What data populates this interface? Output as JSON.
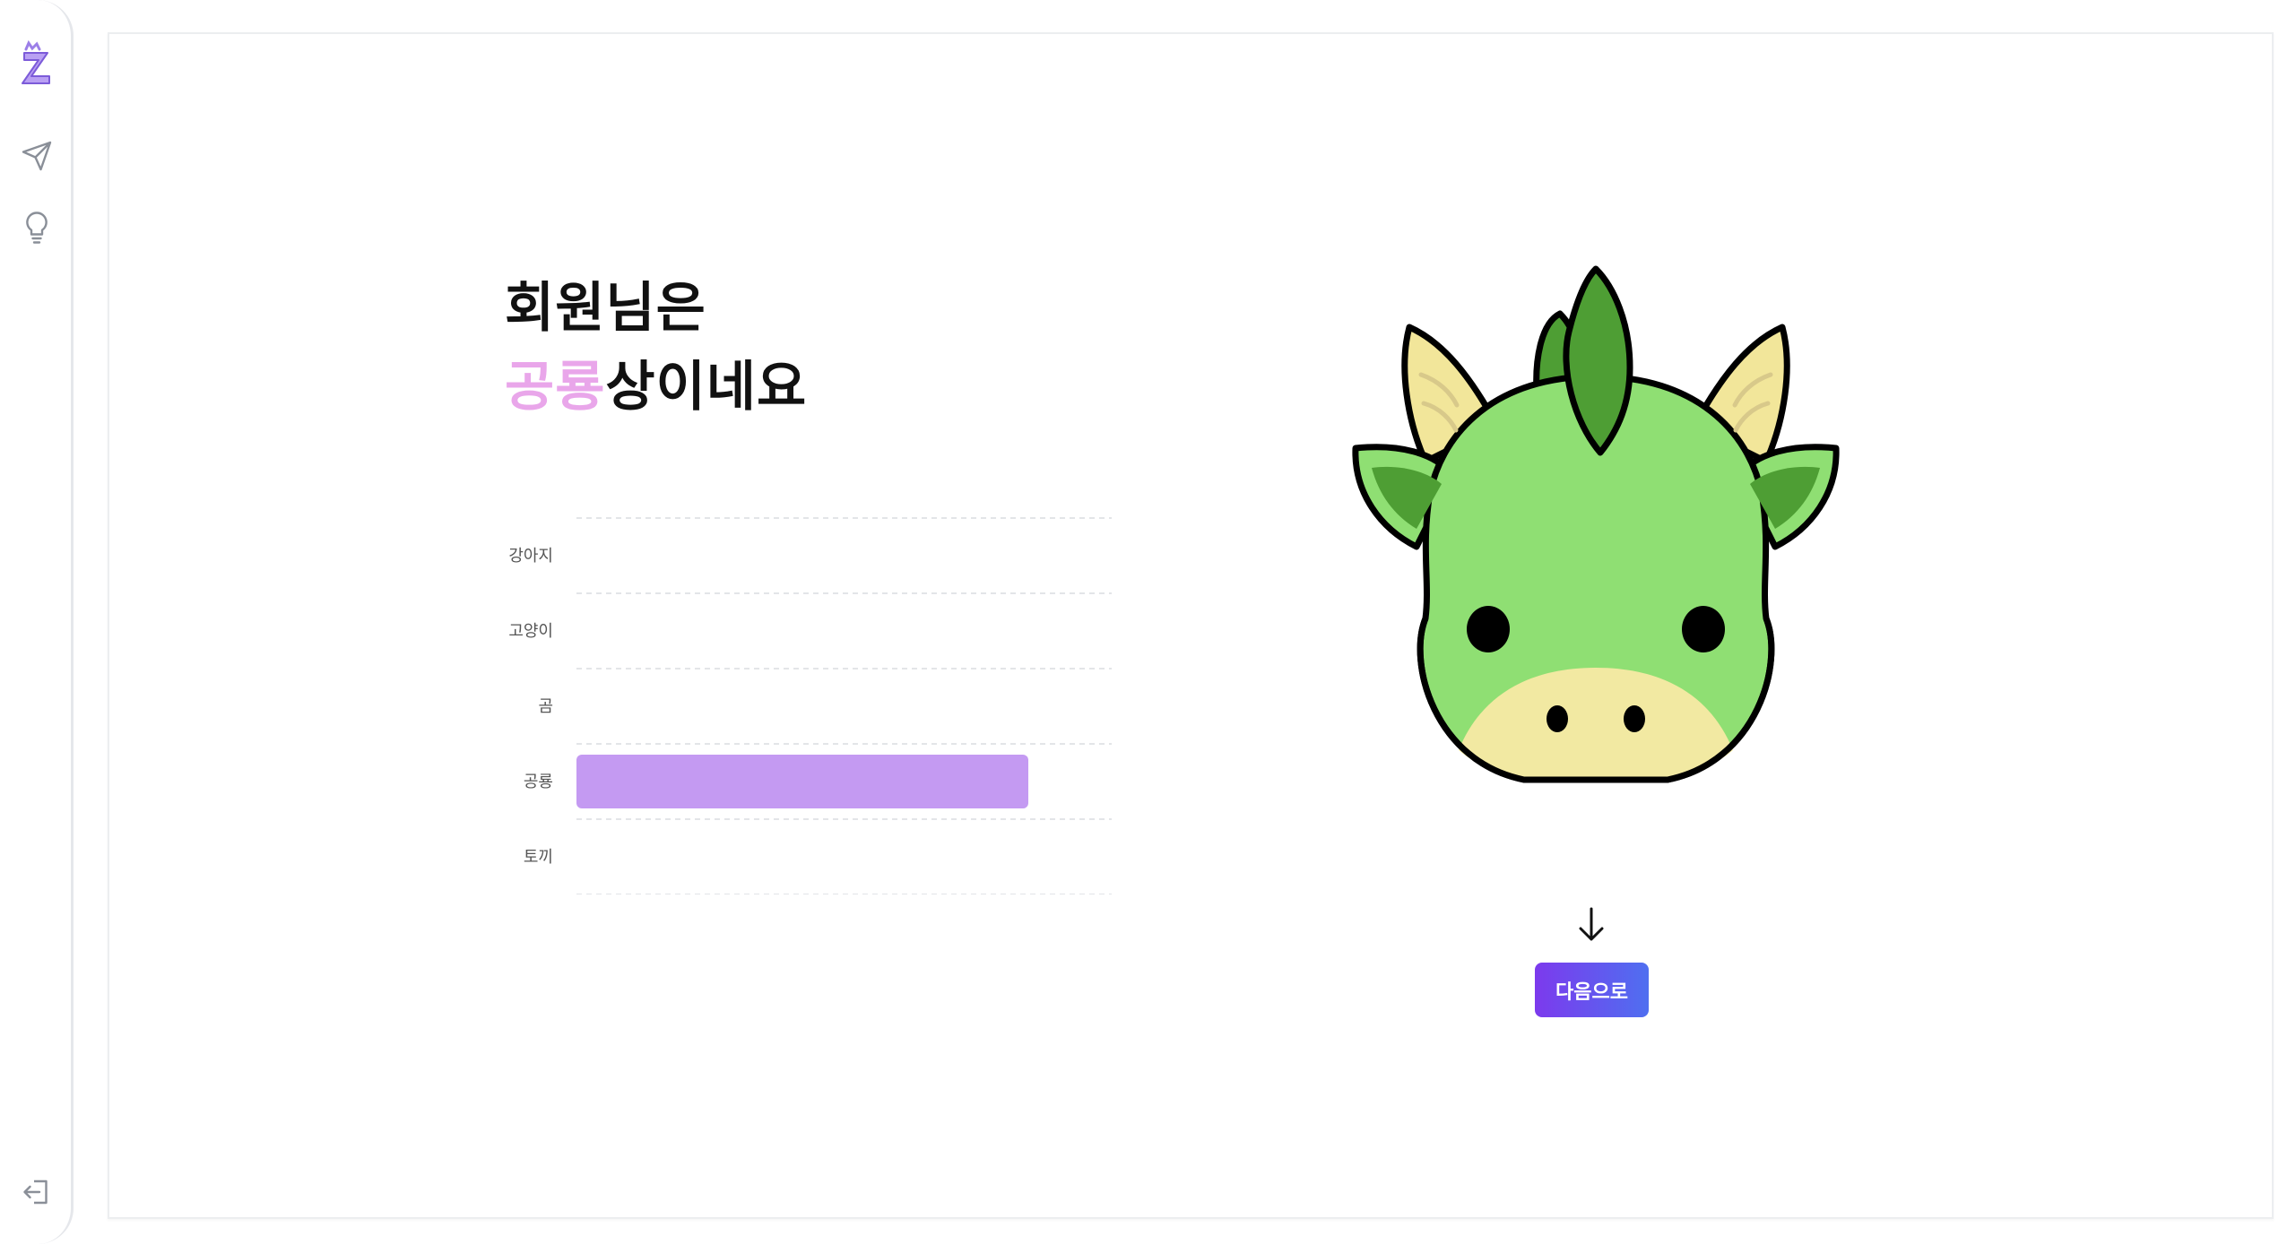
{
  "title": {
    "line1": "회원님은",
    "highlight": "공룡",
    "line2_rest": "상이네요"
  },
  "nav": {
    "items": [
      "logo",
      "send",
      "idea"
    ],
    "logout": "logout"
  },
  "next_button": {
    "label": "다음으로"
  },
  "colors": {
    "accent": "#c49af2",
    "highlight_text": "#e9a6ea",
    "button_start": "#7c3aed",
    "button_end": "#4f6ff0",
    "dragon": "#8fdf73"
  },
  "chart_data": {
    "type": "bar",
    "orientation": "horizontal",
    "categories": [
      "강아지",
      "고양이",
      "곰",
      "공룡",
      "토끼"
    ],
    "values": [
      0,
      0,
      0,
      84,
      0
    ],
    "xlim": [
      0,
      100
    ],
    "grid": true
  }
}
